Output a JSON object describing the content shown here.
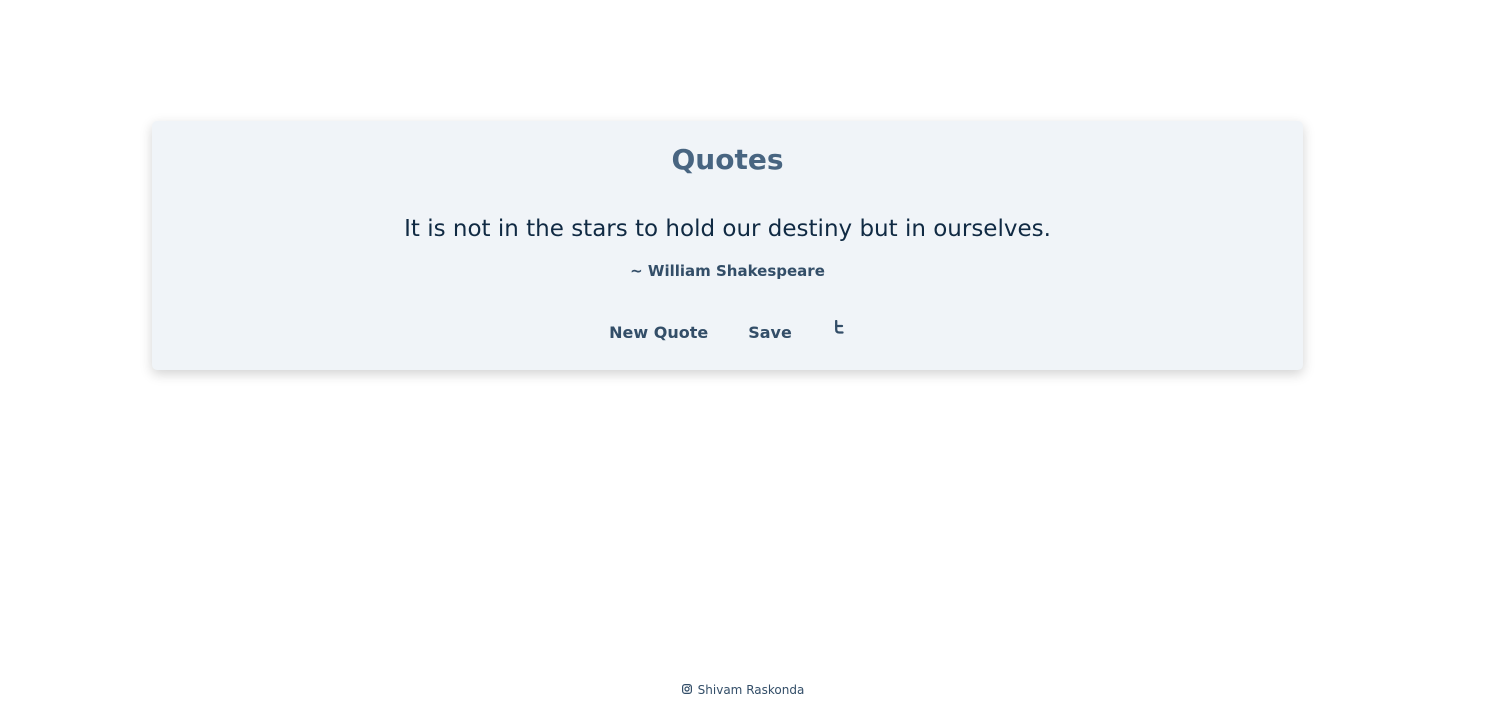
{
  "card": {
    "title": "Quotes",
    "quote": "It is not in the stars to hold our destiny but in ourselves.",
    "author": "~ William Shakespeare"
  },
  "actions": {
    "new_quote_label": "New Quote",
    "save_label": "Save",
    "tweet_icon": "twitter-icon"
  },
  "footer": {
    "icon": "instagram-icon",
    "author_name": "Shivam Raskonda"
  },
  "colors": {
    "card_background": "#f0f4f8",
    "title": "#486581",
    "quote_text": "#102a43",
    "secondary_text": "#334e68"
  }
}
